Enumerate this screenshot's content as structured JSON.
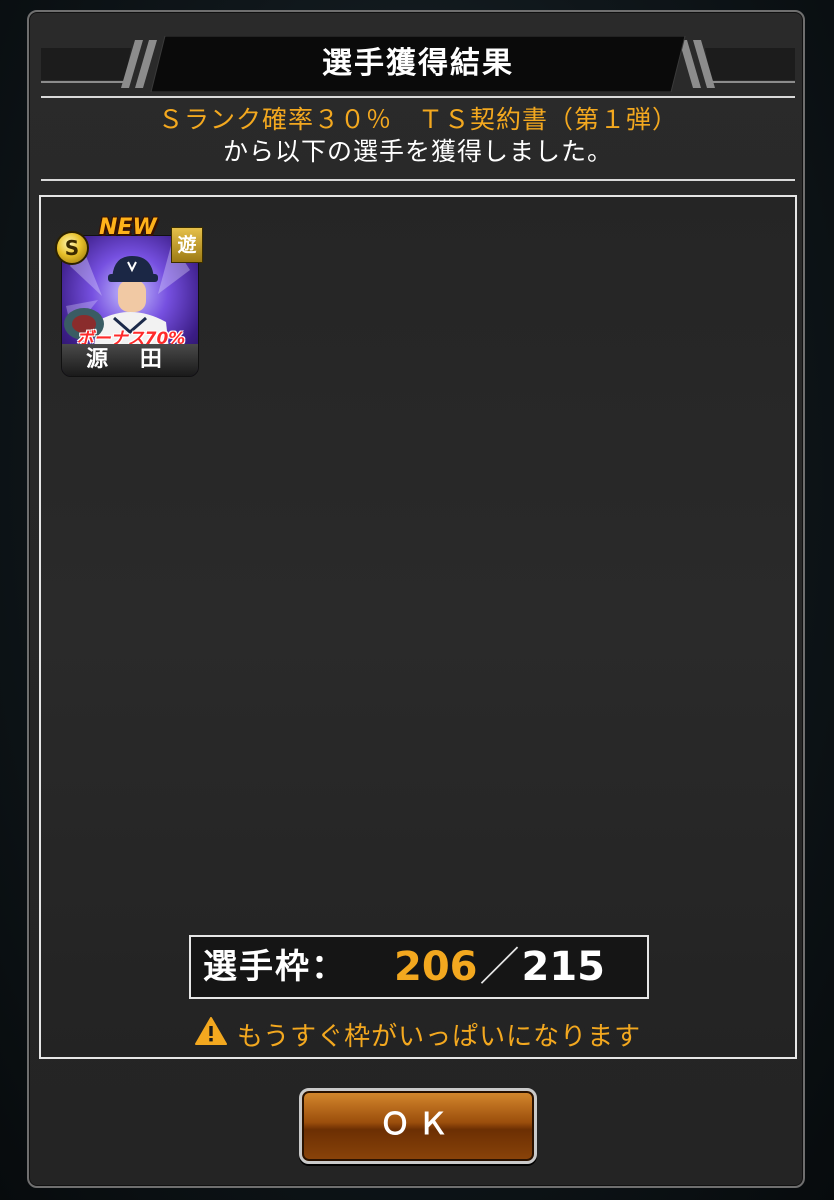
{
  "dialog": {
    "title": "選手獲得結果",
    "gacha_name": "Ｓランク確率３０％　ＴＳ契約書（第１弾）",
    "result_message": "から以下の選手を獲得しました。"
  },
  "players": [
    {
      "rank": "S",
      "new_label": "NEW",
      "position": "遊",
      "bonus": "ボーナス70%",
      "name": "源 田"
    }
  ],
  "slots": {
    "label": "選手枠：",
    "current": "206",
    "separator": "／",
    "max": "215",
    "warning": "もうすぐ枠がいっぱいになります"
  },
  "actions": {
    "ok_label": "ＯＫ"
  },
  "colors": {
    "accent_orange": "#f3a81f",
    "panel_border": "#e6e6e6",
    "button_brown": "#9b4e0c"
  },
  "icons": {
    "warning": "warning-triangle-icon"
  }
}
